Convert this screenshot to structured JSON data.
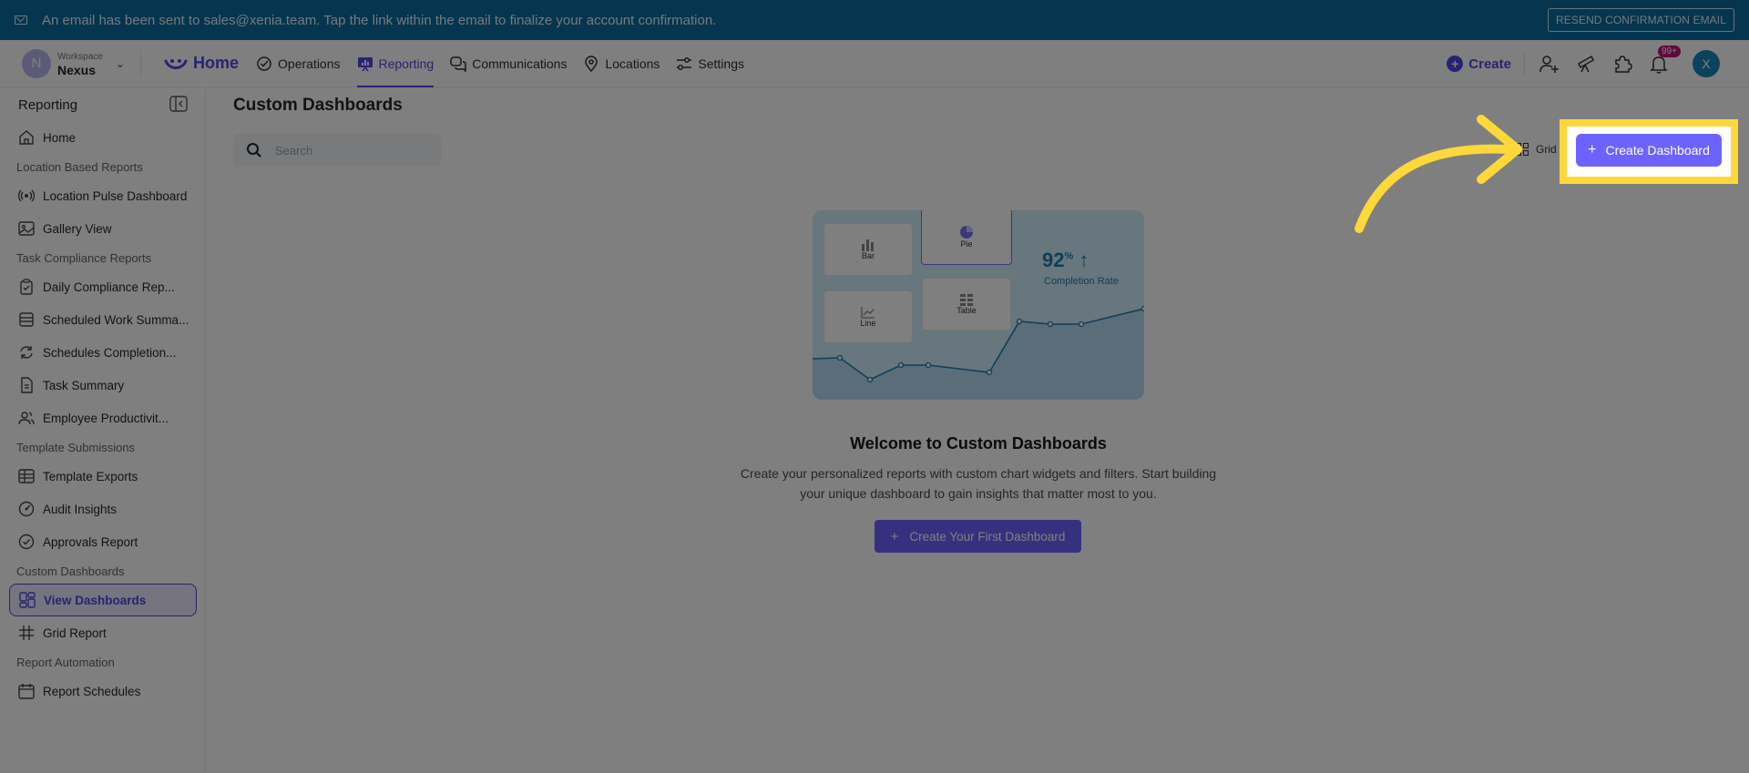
{
  "banner": {
    "message": "An email has been sent to sales@xenia.team. Tap the link within the email to finalize your account confirmation.",
    "resend_label": "RESEND CONFIRMATION EMAIL"
  },
  "workspace": {
    "initial": "N",
    "label": "Workspace",
    "name": "Nexus"
  },
  "nav": {
    "home": "Home",
    "items": [
      "Operations",
      "Reporting",
      "Communications",
      "Locations",
      "Settings"
    ],
    "active": "Reporting"
  },
  "topbar": {
    "create_label": "Create",
    "notification_badge": "99+",
    "user_initial": "X"
  },
  "sidebar": {
    "title": "Reporting",
    "home": "Home",
    "groups": [
      {
        "title": "Location Based Reports",
        "items": [
          "Location Pulse Dashboard",
          "Gallery View"
        ]
      },
      {
        "title": "Task Compliance Reports",
        "items": [
          "Daily Compliance Rep...",
          "Scheduled Work Summa...",
          "Schedules Completion...",
          "Task Summary",
          "Employee Productivit..."
        ]
      },
      {
        "title": "Template Submissions",
        "items": [
          "Template Exports",
          "Audit Insights",
          "Approvals Report"
        ]
      },
      {
        "title": "Custom Dashboards",
        "items": [
          "View Dashboards",
          "Grid Report"
        ]
      },
      {
        "title": "Report Automation",
        "items": [
          "Report Schedules"
        ]
      }
    ],
    "active_item": "View Dashboards"
  },
  "main": {
    "title": "Custom Dashboards",
    "search_placeholder": "Search",
    "view_toggle": "Grid",
    "create_button": "Create Dashboard",
    "illustration": {
      "cards": [
        "Bar",
        "Pie",
        "Line",
        "Table"
      ],
      "stat_value": "92",
      "stat_unit": "%",
      "stat_label": "Completion Rate"
    },
    "welcome_title": "Welcome to Custom Dashboards",
    "welcome_desc_line1": "Create your personalized reports with custom chart widgets and filters. Start building",
    "welcome_desc_line2": "your unique dashboard to gain insights that matter most to you.",
    "first_button": "Create Your First Dashboard"
  },
  "colors": {
    "banner": "#0b6b9e",
    "accent": "#4f46e5",
    "button": "#6c63ff",
    "highlight": "#fdd83a"
  }
}
